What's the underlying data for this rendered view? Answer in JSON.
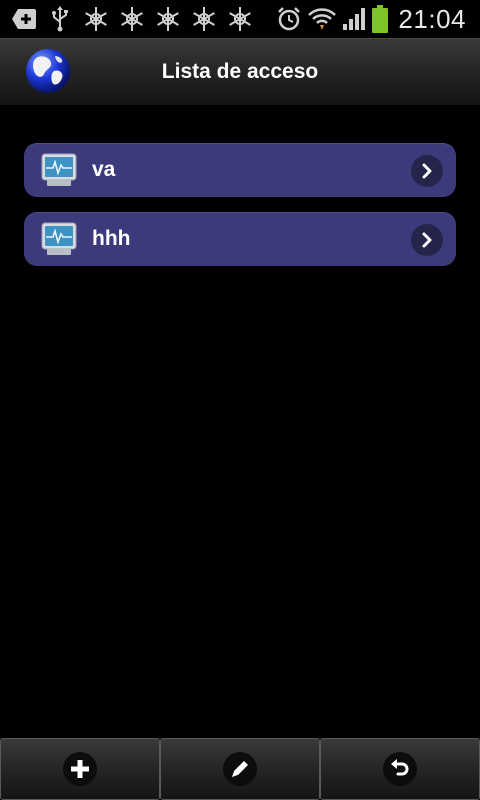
{
  "status_bar": {
    "time": "21:04",
    "icons_left": [
      "add-notification-icon",
      "usb-icon",
      "snowflake-icon",
      "snowflake-icon",
      "snowflake-icon",
      "snowflake-icon",
      "snowflake-icon"
    ],
    "icons_right": [
      "alarm-icon",
      "wifi-icon",
      "signal-icon",
      "battery-icon"
    ]
  },
  "header": {
    "title": "Lista de acceso",
    "logo_icon": "globe-icon"
  },
  "list": {
    "items": [
      {
        "label": "va",
        "icon": "monitor-pulse-icon"
      },
      {
        "label": "hhh",
        "icon": "monitor-pulse-icon"
      }
    ]
  },
  "toolbar": {
    "buttons": [
      "add-button",
      "edit-button",
      "undo-button"
    ]
  },
  "colors": {
    "item_background": "#3d3a7b",
    "background": "#000000",
    "battery": "#7dc52b"
  }
}
